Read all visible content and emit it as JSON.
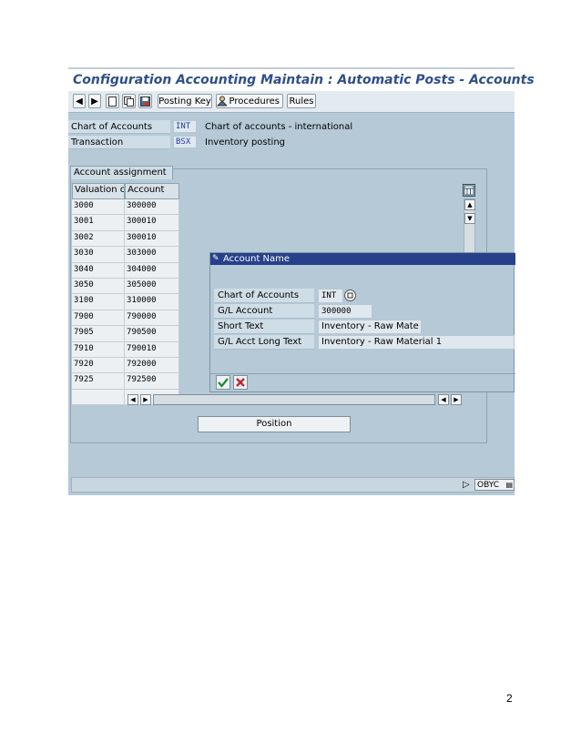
{
  "window": {
    "title": "Configuration Accounting Maintain : Automatic Posts - Accounts"
  },
  "toolbar": {
    "posting_key_label": "Posting Key",
    "procedures_label": "Procedures",
    "rules_label": "Rules"
  },
  "header": {
    "chart_label": "Chart of Accounts",
    "chart_code": "INT",
    "chart_desc": "Chart of accounts - international",
    "transaction_label": "Transaction",
    "transaction_code": "BSX",
    "transaction_desc": "Inventory posting"
  },
  "group": {
    "tab_label": "Account assignment"
  },
  "table": {
    "columns": [
      "Valuation cl_",
      "Account"
    ],
    "rows": [
      [
        "3000",
        "300000"
      ],
      [
        "3001",
        "300010"
      ],
      [
        "3002",
        "300010"
      ],
      [
        "3030",
        "303000"
      ],
      [
        "3040",
        "304000"
      ],
      [
        "3050",
        "305000"
      ],
      [
        "3100",
        "310000"
      ],
      [
        "7900",
        "790000"
      ],
      [
        "7905",
        "790500"
      ],
      [
        "7910",
        "790010"
      ],
      [
        "7920",
        "792000"
      ],
      [
        "7925",
        "792500"
      ]
    ]
  },
  "popup": {
    "title": "Account Name",
    "fields": [
      {
        "label": "Chart of Accounts",
        "value": "INT"
      },
      {
        "label": "G/L Account",
        "value": "300000"
      },
      {
        "label": "Short Text",
        "value": "Inventory - Raw Mate"
      },
      {
        "label": "G/L Acct Long Text",
        "value": "Inventory - Raw Material 1"
      }
    ]
  },
  "position_button": "Position",
  "status": {
    "transaction": "OBYC"
  },
  "page_number": "2",
  "icons": {
    "back": "back-arrow-icon",
    "forward": "forward-arrow-icon",
    "new": "new-entries-icon",
    "copy": "copy-icon",
    "save": "save-icon",
    "procedures": "procedures-icon",
    "table_settings": "table-settings-icon",
    "confirm": "check-icon",
    "cancel": "cancel-icon"
  },
  "colors": {
    "title": "#2f4f8a",
    "popup_title_bg": "#27408b",
    "screen_bg": "#b5c9d6"
  }
}
